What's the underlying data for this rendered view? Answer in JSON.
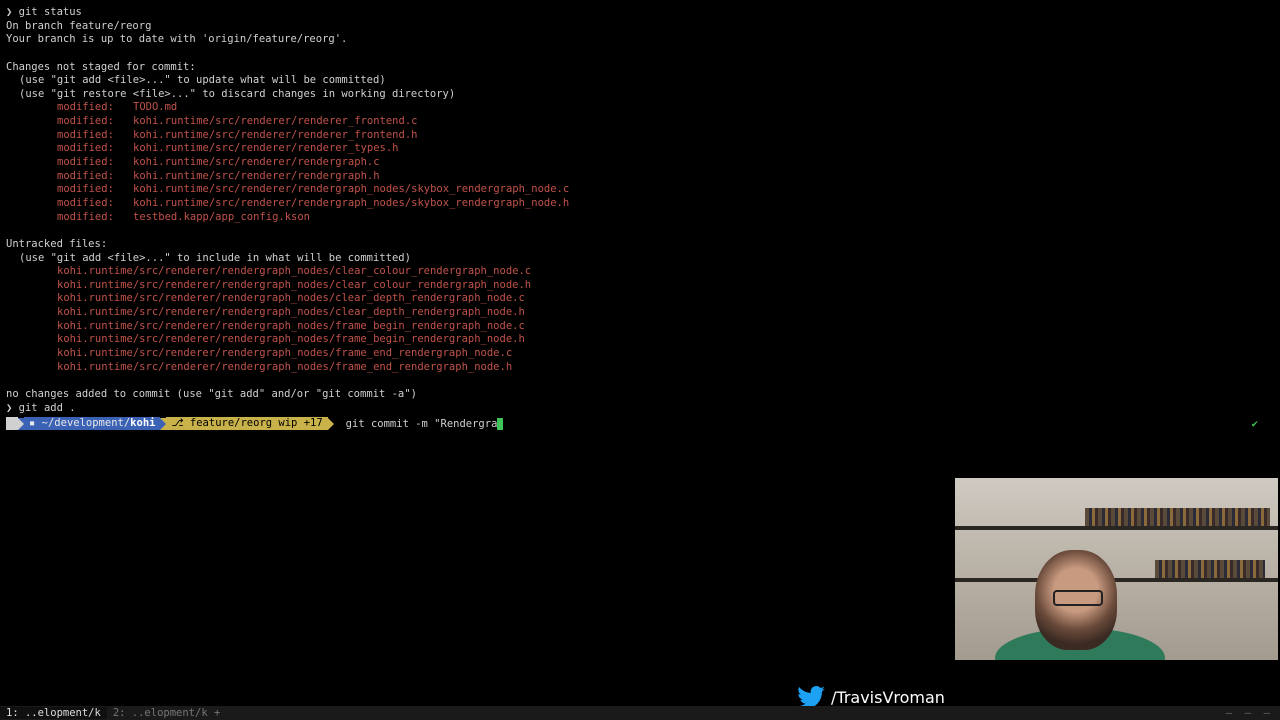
{
  "terminal": {
    "prompt_symbol": "❯",
    "cmd1": "git status",
    "on_branch": "On branch feature/reorg",
    "up_to_date": "Your branch is up to date with 'origin/feature/reorg'.",
    "changes_header": "Changes not staged for commit:",
    "hint_add": "(use \"git add <file>...\" to update what will be committed)",
    "hint_restore": "(use \"git restore <file>...\" to discard changes in working directory)",
    "modified_label": "modified:",
    "modified_files": [
      "TODO.md",
      "kohi.runtime/src/renderer/renderer_frontend.c",
      "kohi.runtime/src/renderer/renderer_frontend.h",
      "kohi.runtime/src/renderer/renderer_types.h",
      "kohi.runtime/src/renderer/rendergraph.c",
      "kohi.runtime/src/renderer/rendergraph.h",
      "kohi.runtime/src/renderer/rendergraph_nodes/skybox_rendergraph_node.c",
      "kohi.runtime/src/renderer/rendergraph_nodes/skybox_rendergraph_node.h",
      "testbed.kapp/app_config.kson"
    ],
    "untracked_header": "Untracked files:",
    "hint_untracked": "(use \"git add <file>...\" to include in what will be committed)",
    "untracked_files": [
      "kohi.runtime/src/renderer/rendergraph_nodes/clear_colour_rendergraph_node.c",
      "kohi.runtime/src/renderer/rendergraph_nodes/clear_colour_rendergraph_node.h",
      "kohi.runtime/src/renderer/rendergraph_nodes/clear_depth_rendergraph_node.c",
      "kohi.runtime/src/renderer/rendergraph_nodes/clear_depth_rendergraph_node.h",
      "kohi.runtime/src/renderer/rendergraph_nodes/frame_begin_rendergraph_node.c",
      "kohi.runtime/src/renderer/rendergraph_nodes/frame_begin_rendergraph_node.h",
      "kohi.runtime/src/renderer/rendergraph_nodes/frame_end_rendergraph_node.c",
      "kohi.runtime/src/renderer/rendergraph_nodes/frame_end_rendergraph_node.h"
    ],
    "no_changes": "no changes added to commit (use \"git add\" and/or \"git commit -a\")",
    "cmd2": "git add ."
  },
  "prompt": {
    "os_glyph": "",
    "dir_prefix": "~/development/",
    "dir_current": "kohi",
    "git_glyph": "⎇",
    "git_info": "feature/reorg wip +17",
    "typed_command": "git commit -m \"Rendergra",
    "status_check": "✔"
  },
  "overlay": {
    "twitter_handle": "/TravisVroman"
  },
  "statusbar": {
    "windows": [
      {
        "label": "1: ..elopment/k"
      },
      {
        "label": "2: ..elopment/k +"
      }
    ]
  },
  "colors": {
    "modified": "#c0524a",
    "prompt_dir_bg": "#3b62b5",
    "prompt_git_bg": "#c9b24a",
    "cursor": "#3fc45a"
  }
}
